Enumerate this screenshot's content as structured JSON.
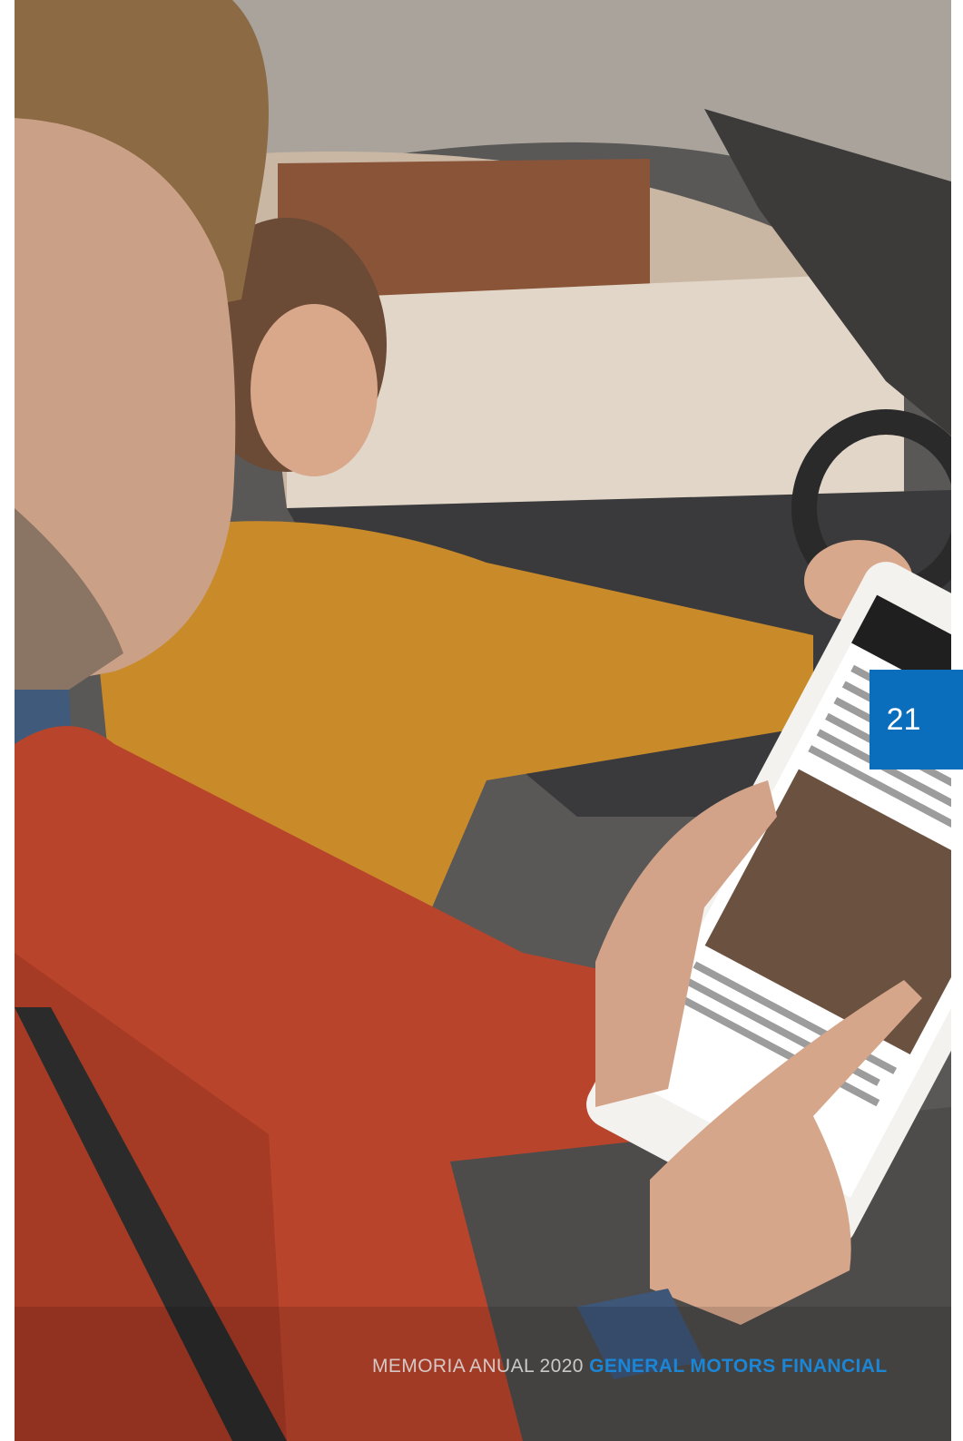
{
  "page_number": "21",
  "footer": {
    "prefix": "MEMORIA ANUAL 2020 ",
    "brand": "GENERAL MOTORS FINANCIAL"
  },
  "photo": {
    "subject": "person-using-tablet-in-car"
  },
  "colors": {
    "accent_blue": "#0a6ebd",
    "brand_text_blue": "#1b86d6"
  }
}
